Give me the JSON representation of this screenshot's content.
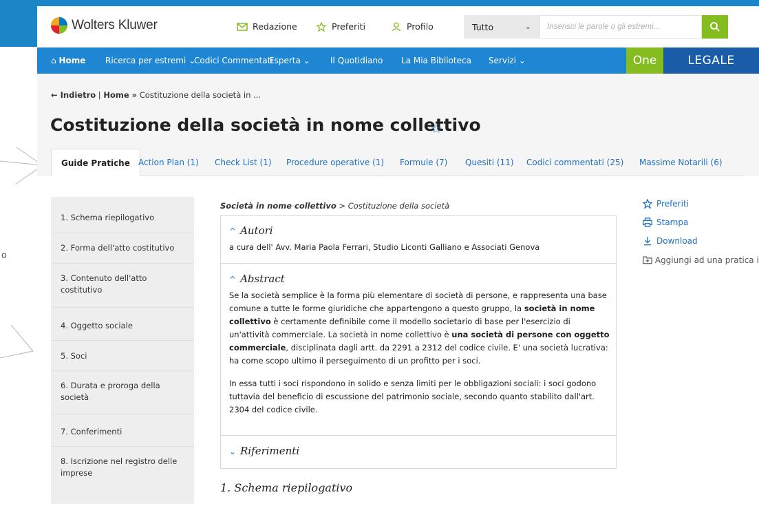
{
  "header": {
    "logo": "Wolters Kluwer",
    "redazione": "Redazione",
    "preferiti": "Preferiti",
    "profilo": "Profilo",
    "select_value": "Tutto",
    "search_placeholder": "Inserisci le parole o gli estremi..."
  },
  "nav": {
    "home": "Home",
    "items": [
      "Ricerca per estremi",
      "Codici Commentati",
      "Esperta",
      "Il Quotidiano",
      "La Mia Biblioteca",
      "Servizi"
    ],
    "one": "One",
    "legale": "LEGALE"
  },
  "breadcrumb": {
    "back": "← Indietro",
    "home": "Home »",
    "current": "Costituzione della società in ..."
  },
  "title": "Costituzione della società in nome collettivo",
  "tabs": [
    "Guide Pratiche",
    "Action Plan (1)",
    "Check List (1)",
    "Procedure operative (1)",
    "Formule (7)",
    "Quesiti (11)",
    "Codici commentati (25)",
    "Massime Notarili (6)"
  ],
  "sidebar": [
    "1. Schema riepilogativo",
    "2. Forma dell'atto costitutivo",
    "3. Contenuto dell'atto costitutivo",
    "4. Oggetto sociale",
    "5. Soci",
    "6. Durata e proroga della società",
    "7. Conferimenti",
    "8. Iscrizione nel registro delle imprese"
  ],
  "content": {
    "crumb_bold": "Società in nome collettivo",
    "crumb_rest": " > Costituzione della società",
    "autori_title": "Autori",
    "autori_text": "a cura dell' Avv. Maria Paola Ferrari, Studio Liconti Galliano e Associati Genova",
    "abstract_title": "Abstract",
    "abstract_p1_a": "Se la società semplice è la forma più elementare di società di persone, e rappresenta una base comune a tutte le forme giuridiche che appartengono a questo gruppo, la ",
    "abstract_p1_b": "società in nome collettivo",
    "abstract_p1_c": " è certamente definibile come il modello societario di base per l'esercizio di un'attività commerciale. La società in nome collettivo è ",
    "abstract_p1_d": "una società di persone con oggetto commerciale",
    "abstract_p1_e": ", disciplinata dagli artt. da 2291 a 2312 del codice civile. E' una società lucrativa: ha come scopo ultimo il perseguimento di un profitto per i soci.",
    "abstract_p2": "In essa tutti i soci rispondono in solido e senza limiti per le obbligazioni sociali: i soci godono tuttavia del beneficio di escussione del patrimonio sociale, secondo quanto stabilito dall'art. 2304 del codice civile.",
    "riferimenti_title": "Riferimenti",
    "section_heading": "1. Schema riepilogativo"
  },
  "actions": {
    "preferiti": "Preferiti",
    "stampa": "Stampa",
    "download": "Download",
    "aggiungi": "Aggiungi ad una pratica in Kleos"
  },
  "decor": {
    "left_letter": "o"
  },
  "colors": {
    "nav_blue": "#1f86d3",
    "green": "#85bc20",
    "legale_blue": "#1a5ca8"
  }
}
